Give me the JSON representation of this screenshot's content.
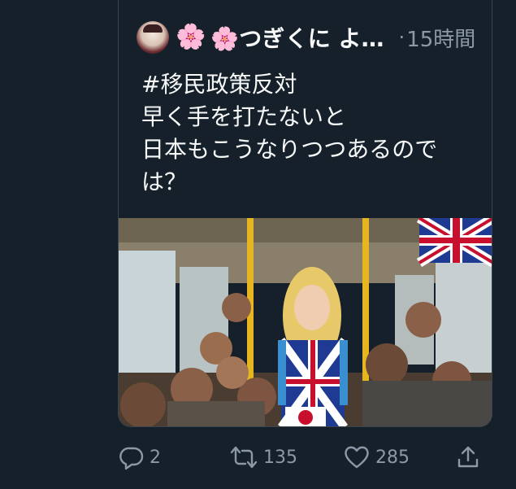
{
  "tweet": {
    "display_name": "🌸つぎくに よ…",
    "separator": "·",
    "timestamp": "15時間",
    "text_lines": [
      "#移民政策反対",
      "早く手を打たないと",
      "日本もこうなりつつあるので",
      "は？"
    ]
  },
  "icons": {
    "flower": "cherry-blossom-icon",
    "reply": "reply-icon",
    "retweet": "retweet-icon",
    "like": "heart-icon",
    "share": "share-icon"
  },
  "actions": {
    "reply_count": "2",
    "retweet_count": "135",
    "like_count": "285"
  },
  "colors": {
    "background": "#15202b",
    "border": "#38444d",
    "text": "#f7f9f9",
    "muted": "#8b98a5"
  }
}
